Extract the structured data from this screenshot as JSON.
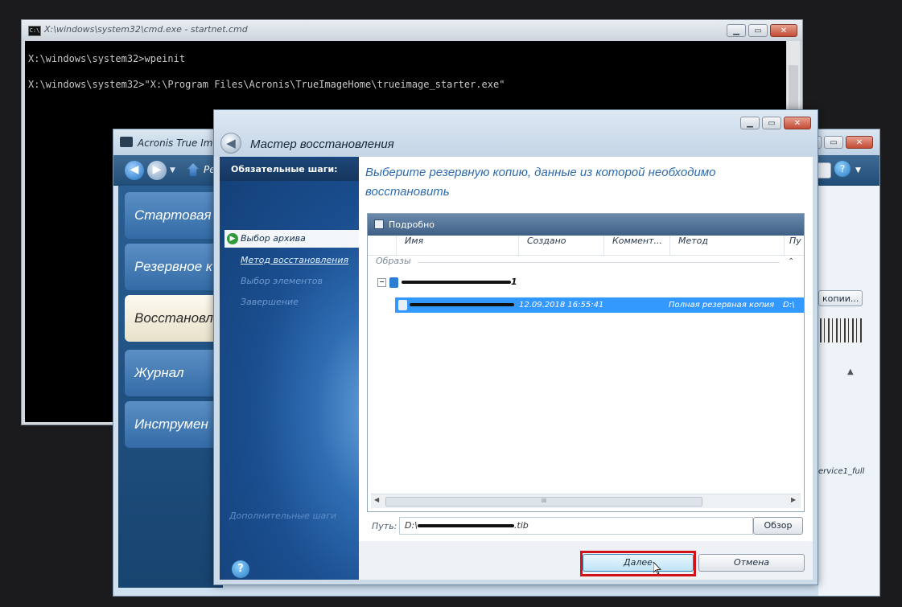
{
  "cmd": {
    "title": "X:\\windows\\system32\\cmd.exe - startnet.cmd",
    "icon": "C:\\",
    "lines": [
      "X:\\windows\\system32>wpeinit",
      "X:\\windows\\system32>\"X:\\Program Files\\Acronis\\TrueImageHome\\trueimage_starter.exe\""
    ]
  },
  "acronis": {
    "title": "Acronis True Image",
    "toolbar_item": "Ре",
    "nav": [
      "Стартовая",
      "Резервное к",
      "Восстановл",
      "Журнал",
      "Инструмен"
    ],
    "right_button": "копии...",
    "right_label": "ervice1_full"
  },
  "wizard": {
    "title": "Мастер восстановления",
    "steps_header": "Обязательные шаги:",
    "steps": [
      "Выбор архива",
      "Метод восстановления",
      "Выбор элементов",
      "Завершение"
    ],
    "ghost_text": "Дополнительные шаги",
    "heading": "Выберите резервную копию, данные из которой необходимо восстановить",
    "panel_title": "Подробно",
    "columns": [
      "Имя",
      "Создано",
      "Коммент...",
      "Метод",
      "Пу"
    ],
    "group": "Образы",
    "archive": {
      "name_tail": "1",
      "date": "12.09.2018 16:55:41",
      "method": "Полная резервная копия",
      "path_short": "D:\\"
    },
    "scroll_grip": "III",
    "path_label": "Путь:",
    "path_prefix": "D:\\",
    "path_suffix": ".tib",
    "browse": "Обзор",
    "next": "Далее",
    "cancel": "Отмена",
    "help": "?"
  },
  "colors": {
    "selection": "#3399ff",
    "highlight_box": "#d0121a",
    "heading": "#2f6cad"
  }
}
